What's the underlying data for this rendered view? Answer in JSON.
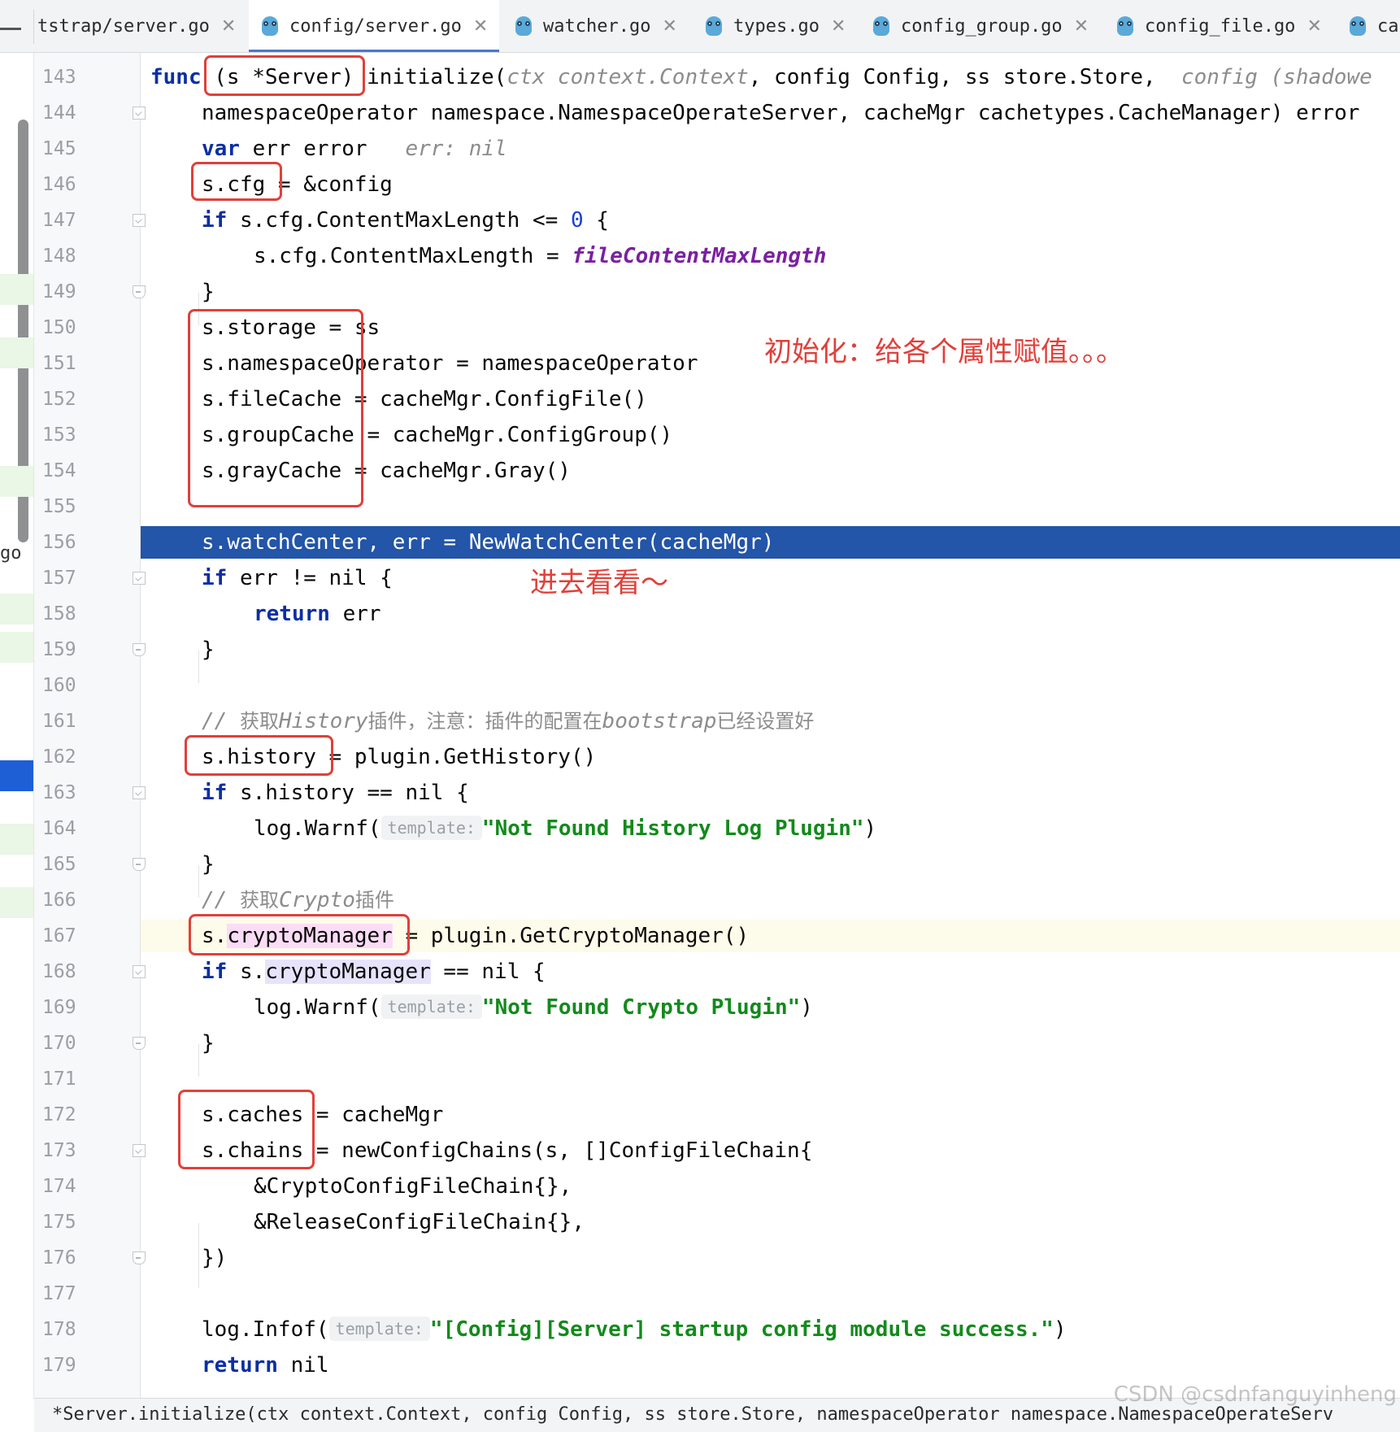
{
  "tabs": [
    {
      "label": "tstrap/server.go",
      "icon": "none",
      "active": false
    },
    {
      "label": "config/server.go",
      "icon": "gopher-icon",
      "active": true
    },
    {
      "label": "watcher.go",
      "icon": "gopher-icon",
      "active": false
    },
    {
      "label": "types.go",
      "icon": "gopher-icon",
      "active": false
    },
    {
      "label": "config_group.go",
      "icon": "gopher-icon",
      "active": false
    },
    {
      "label": "config_file.go",
      "icon": "gopher-icon",
      "active": false
    },
    {
      "label": "ca",
      "icon": "gopher-icon",
      "active": false
    }
  ],
  "left_fragment": "go",
  "line_numbers": [
    "143",
    "144",
    "145",
    "146",
    "147",
    "148",
    "149",
    "150",
    "151",
    "152",
    "153",
    "154",
    "155",
    "156",
    "157",
    "158",
    "159",
    "160",
    "161",
    "162",
    "163",
    "164",
    "165",
    "166",
    "167",
    "168",
    "169",
    "170",
    "171",
    "172",
    "173",
    "174",
    "175",
    "176",
    "177",
    "178",
    "179"
  ],
  "code": {
    "l143": {
      "kw": "func",
      "sig": " (s *Server) initialize(",
      "ctx": "ctx context.Context",
      "rest": ", config Config, ss store.Store,",
      "hint": "config (shadowe"
    },
    "l144": {
      "text": "namespaceOperator namespace.NamespaceOperateServer, cacheMgr cachetypes.CacheManager) error"
    },
    "l145": {
      "kw": "var",
      "text": " err error",
      "hint": "err: nil"
    },
    "l146": {
      "text": "s.cfg = &config"
    },
    "l147": {
      "kw": "if",
      "text": " s.cfg.ContentMaxLength <= ",
      "num": "0",
      "tail": " {"
    },
    "l148": {
      "text": "s.cfg.ContentMaxLength = ",
      "const": "fileContentMaxLength"
    },
    "l149": {
      "text": "}"
    },
    "l150": {
      "text": "s.storage = ss"
    },
    "l151": {
      "text": "s.namespaceOperator = namespaceOperator"
    },
    "l152": {
      "text": "s.fileCache = cacheMgr.ConfigFile()"
    },
    "l153": {
      "text": "s.groupCache = cacheMgr.ConfigGroup()"
    },
    "l154": {
      "text": "s.grayCache = cacheMgr.Gray()"
    },
    "l156": {
      "text": "s.watchCenter, err = NewWatchCenter(cacheMgr)"
    },
    "l157": {
      "kw": "if",
      "text": " err != nil {"
    },
    "l158": {
      "kw": "return",
      "text": " err"
    },
    "l159": {
      "text": "}"
    },
    "l161": {
      "slash": "// ",
      "a": "获取",
      "b": "History",
      "c": "插件，注意：插件的配置在",
      "d": "bootstrap",
      "e": "已经设置好"
    },
    "l162": {
      "text": "s.history = plugin.GetHistory()"
    },
    "l163": {
      "kw": "if",
      "text": " s.history == nil {"
    },
    "l164": {
      "pre": "log.Warnf(",
      "ph": "template:",
      "str": "\"Not Found History Log Plugin\"",
      "post": ")"
    },
    "l165": {
      "text": "}"
    },
    "l166": {
      "slash": "// ",
      "a": "获取",
      "b": "Crypto",
      "c": "插件"
    },
    "l167": {
      "pre": "s.",
      "hl": "cryptoManager",
      "post": " = plugin.GetCryptoManager()"
    },
    "l168": {
      "kw": "if",
      "pre": " s.",
      "hl": "cryptoManager",
      "post": " == nil {"
    },
    "l169": {
      "pre": "log.Warnf(",
      "ph": "template:",
      "str": "\"Not Found Crypto Plugin\"",
      "post": ")"
    },
    "l170": {
      "text": "}"
    },
    "l172": {
      "text": "s.caches = cacheMgr"
    },
    "l173": {
      "text": "s.chains = newConfigChains(s, []ConfigFileChain{"
    },
    "l174": {
      "text": "&CryptoConfigFileChain{},"
    },
    "l175": {
      "text": "&ReleaseConfigFileChain{},"
    },
    "l176": {
      "text": "})"
    },
    "l178": {
      "pre": "log.Infof(",
      "ph": "template:",
      "str": "\"[Config][Server] startup config module success.\"",
      "post": ")"
    },
    "l179": {
      "kw": "return",
      "text": " nil"
    }
  },
  "annotations": {
    "init_note": "初始化：给各个属性赋值。。。",
    "enter_note": "进去看看～"
  },
  "status_bar": "*Server.initialize(ctx context.Context, config Config, ss store.Store, namespaceOperator namespace.NamespaceOperateServ",
  "watermark": "CSDN @csdnfanguyinheng",
  "colors": {
    "keyword": "#0b2fa3",
    "string": "#138a1c",
    "execution_line": "#2355a8",
    "annotation_red": "#e0403a",
    "constant": "#7b1fa2"
  }
}
